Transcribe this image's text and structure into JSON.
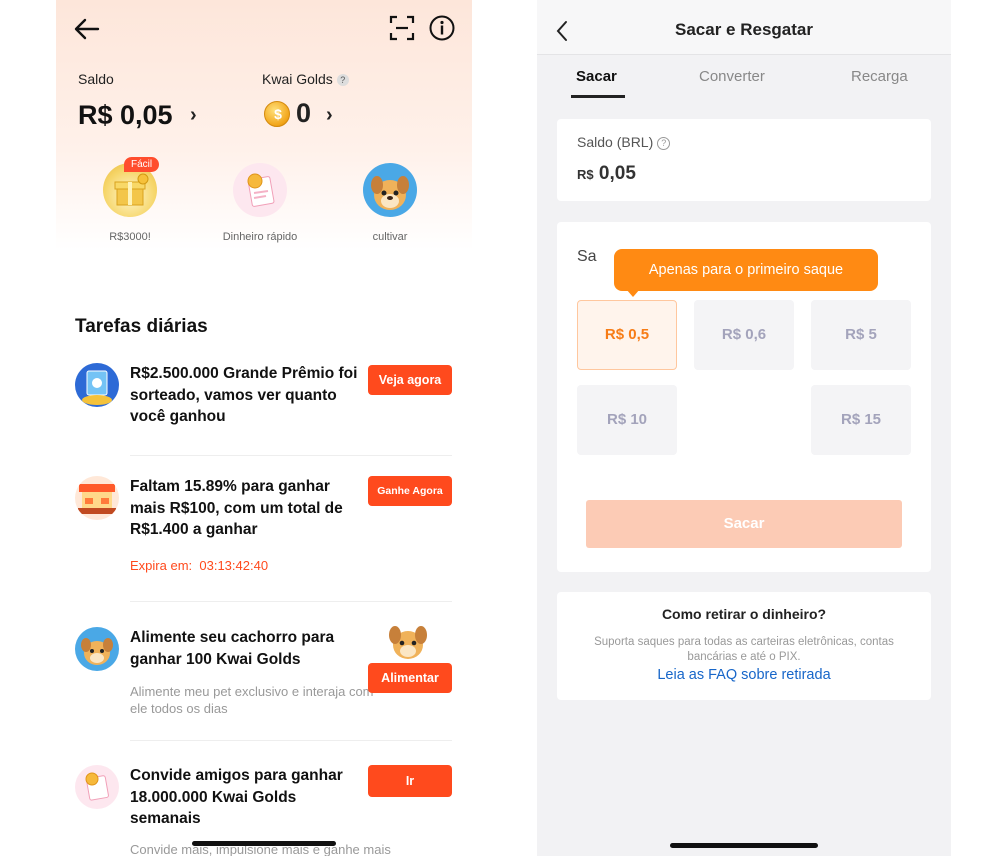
{
  "left": {
    "balance": {
      "label": "Saldo",
      "value": "R$ 0,05",
      "chevron": "›"
    },
    "golds": {
      "label": "Kwai Golds",
      "help": "?",
      "value": "0",
      "chevron": "›",
      "icon": "coin-icon"
    },
    "shortcuts": [
      {
        "label": "R$3000!",
        "badge": "Fácil",
        "icon": "gift-icon"
      },
      {
        "label": "Dinheiro rápido",
        "icon": "cash-card-icon"
      },
      {
        "label": "cultivar",
        "icon": "dog-avatar-icon"
      }
    ],
    "section_title": "Tarefas diárias",
    "tasks": [
      {
        "title": "R$2.500.000 Grande Prêmio foi sorteado, vamos ver quanto você ganhou",
        "button": "Veja agora",
        "icon": "prize-icon"
      },
      {
        "title": "Faltam 15.89% para ganhar mais R$100, com um total de R$1.400 a ganhar",
        "button": "Ganhe Agora",
        "expire_label": "Expira em:",
        "expire_time": "03:13:42:40",
        "icon": "stall-icon"
      },
      {
        "title": "Alimente seu cachorro para ganhar 100 Kwai Golds",
        "desc": "Alimente meu pet exclusivo e interaja com ele todos os dias",
        "button": "Alimentar",
        "icon": "dog-icon"
      },
      {
        "title": "Convide amigos para ganhar 18.000.000 Kwai Golds semanais",
        "desc": "Convide mais, impulsione mais e ganhe mais",
        "button": "Ir",
        "icon": "invite-icon"
      }
    ]
  },
  "right": {
    "title": "Sacar e Resgatar",
    "tabs": [
      "Sacar",
      "Converter",
      "Recarga"
    ],
    "active_tab": "Sacar",
    "balance": {
      "label": "Saldo (BRL)",
      "help": "?",
      "currency": "R$",
      "value": "0,05"
    },
    "withdraw": {
      "label": "Sa",
      "tooltip": "Apenas para o primeiro saque",
      "amounts": [
        "R$ 0,5",
        "R$ 0,6",
        "R$ 5",
        "R$ 10",
        "R$ 15"
      ],
      "selected": "R$ 0,5",
      "button": "Sacar"
    },
    "how": {
      "title": "Como retirar o dinheiro?",
      "desc": "Suporta saques para todas as carteiras eletrônicas, contas bancárias e até o PIX.",
      "link": "Leia as FAQ sobre retirada"
    }
  },
  "colors": {
    "accent": "#ff4a1d",
    "tooltip": "#ff8a13",
    "selected_text": "#f77c16",
    "link": "#1766c9"
  }
}
